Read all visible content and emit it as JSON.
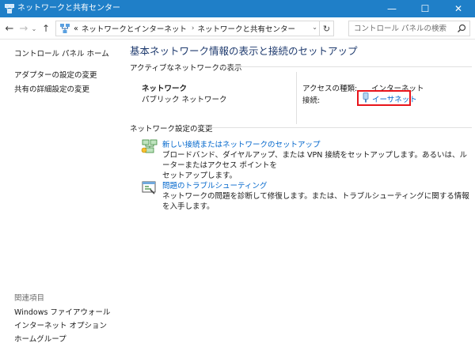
{
  "window": {
    "title": "ネットワークと共有センター",
    "controls": {
      "minimize": "—",
      "maximize": "☐",
      "close": "✕"
    }
  },
  "nav": {
    "back": "←",
    "forward": "→",
    "recent": "⌄",
    "up": "↑"
  },
  "address": {
    "prefix": "«",
    "crumbs": [
      "ネットワークとインターネット",
      "ネットワークと共有センター"
    ],
    "separator": "›",
    "dropdown": "⌄",
    "refresh": "↻"
  },
  "search": {
    "placeholder": "コントロール パネルの検索"
  },
  "sidebar": {
    "home": "コントロール パネル ホーム",
    "items": [
      "アダプターの設定の変更",
      "共有の詳細設定の変更"
    ],
    "see_also_title": "関連項目",
    "see_also": [
      "Windows ファイアウォール",
      "インターネット オプション",
      "ホームグループ"
    ]
  },
  "main": {
    "title": "基本ネットワーク情報の表示と接続のセットアップ",
    "active_section": "アクティブなネットワークの表示",
    "network_name": "ネットワーク",
    "network_type": "パブリック ネットワーク",
    "access_label": "アクセスの種類:",
    "access_value": "インターネット",
    "connection_label": "接続:",
    "connection_value": "イーサネット",
    "settings_section": "ネットワーク設定の変更",
    "tasks": [
      {
        "title": "新しい接続またはネットワークのセットアップ",
        "desc_line1": "ブロードバンド、ダイヤルアップ、または VPN 接続をセットアップします。あるいは、ルーターまたはアクセス ポイントを",
        "desc_line2": "セットアップします。"
      },
      {
        "title": "問題のトラブルシューティング",
        "desc_line1": "ネットワークの問題を診断して修復します。または、トラブルシューティングに関する情報を入手します。"
      }
    ]
  },
  "colors": {
    "titlebar": "#1f7fc8",
    "link": "#0066cc",
    "page_title": "#1e3a6e",
    "highlight": "#e8141b"
  }
}
